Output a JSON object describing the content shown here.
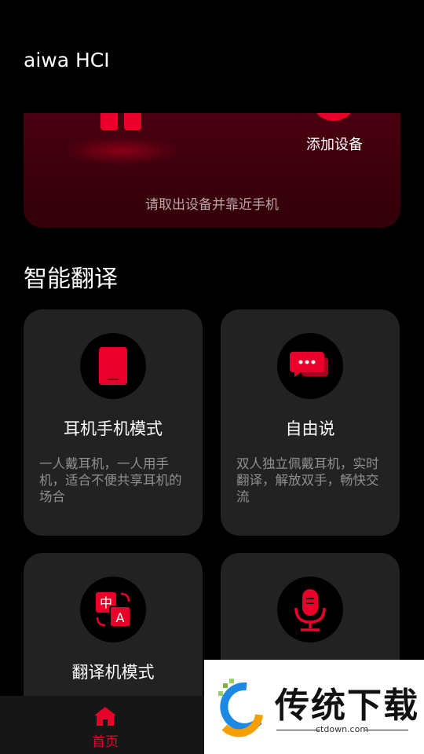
{
  "app": {
    "title": "aiwa HCI"
  },
  "banner": {
    "add_label": "添加设备",
    "hint": "请取出设备并靠近手机"
  },
  "section": {
    "title": "智能翻译"
  },
  "cards": [
    {
      "title": "耳机手机模式",
      "desc": "一人戴耳机，一人用手机，适合不便共享耳机的场合",
      "icon": "phone-icon"
    },
    {
      "title": "自由说",
      "desc": "双人独立佩戴耳机，实时翻译，解放双手，畅快交流",
      "icon": "chat-bubbles-icon"
    },
    {
      "title": "翻译机模式",
      "desc": "",
      "icon": "translate-icon"
    },
    {
      "title": "",
      "desc": "",
      "icon": "microphone-icon"
    }
  ],
  "nav": {
    "home_label": "首页"
  },
  "watermark": {
    "brand": "传统下载",
    "url": "ctdown.com"
  },
  "colors": {
    "accent": "#e8002a",
    "card": "#222222",
    "background": "#000000"
  }
}
